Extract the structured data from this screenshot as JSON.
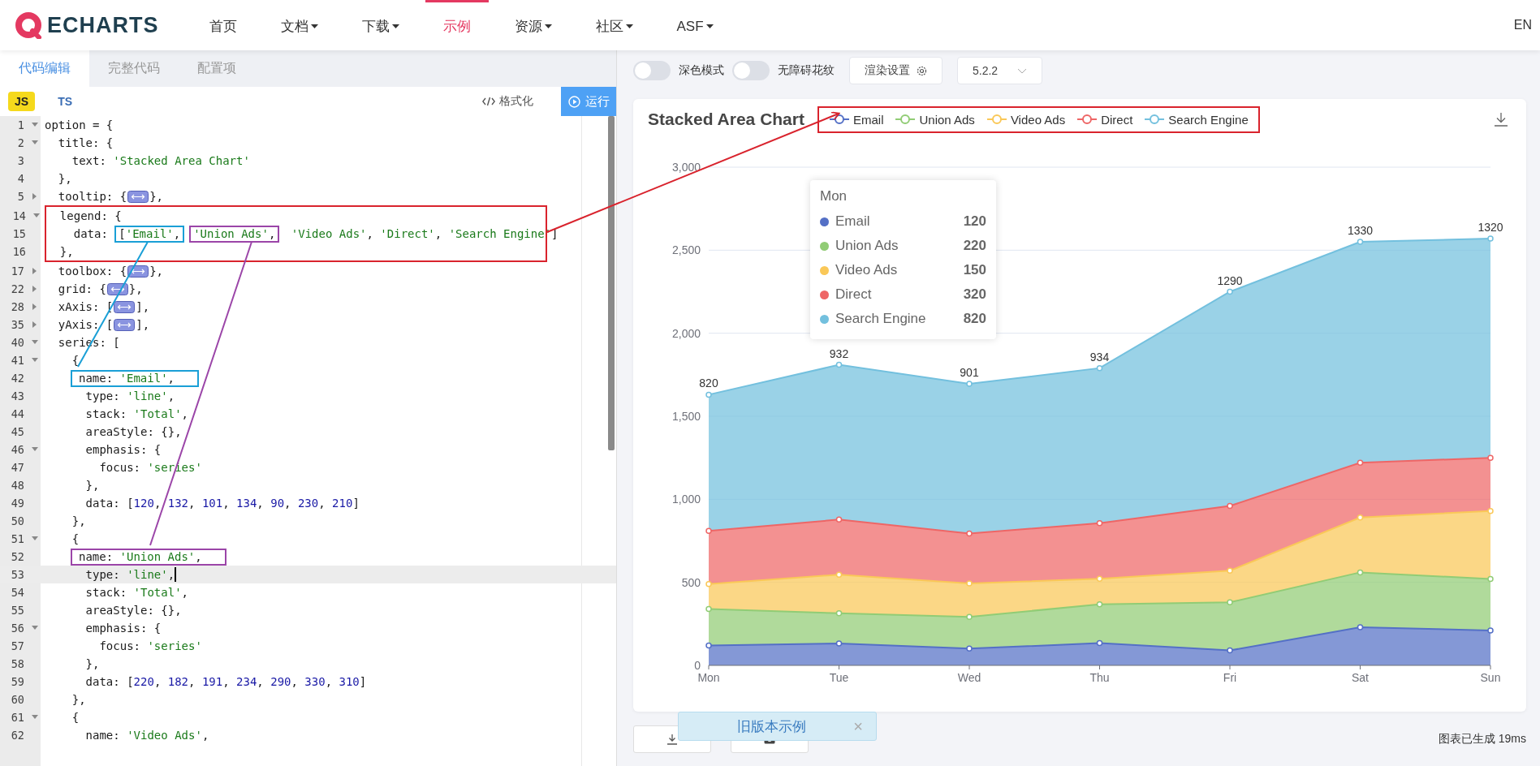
{
  "nav": {
    "logo": "ECHARTS",
    "items": [
      {
        "label": "首页",
        "has_menu": false,
        "selected": false
      },
      {
        "label": "文档",
        "has_menu": true,
        "selected": false
      },
      {
        "label": "下载",
        "has_menu": true,
        "selected": false
      },
      {
        "label": "示例",
        "has_menu": false,
        "selected": true
      },
      {
        "label": "资源",
        "has_menu": true,
        "selected": false
      },
      {
        "label": "社区",
        "has_menu": true,
        "selected": false
      },
      {
        "label": "ASF",
        "has_menu": true,
        "selected": false
      }
    ],
    "language": "EN"
  },
  "editor": {
    "tabs": [
      {
        "label": "代码编辑",
        "selected": true
      },
      {
        "label": "完整代码",
        "selected": false
      },
      {
        "label": "配置项",
        "selected": false
      }
    ],
    "langs": [
      {
        "label": "JS",
        "selected": true
      },
      {
        "label": "TS",
        "selected": false
      }
    ],
    "format_button": "格式化",
    "run_button": "运行",
    "lines": [
      {
        "number": "1",
        "foldable": true,
        "folded": false,
        "current": false,
        "parts": [
          "option = {"
        ]
      },
      {
        "number": "2",
        "foldable": true,
        "folded": false,
        "current": false,
        "parts": [
          "  title: {"
        ]
      },
      {
        "number": "3",
        "foldable": false,
        "current": false,
        "parts": [
          "    text: 'Stacked Area Chart'"
        ]
      },
      {
        "number": "4",
        "foldable": false,
        "current": false,
        "parts": [
          "  },"
        ]
      },
      {
        "number": "5",
        "foldable": true,
        "folded": true,
        "current": false,
        "parts": [
          "  tooltip: {",
          "},"
        ]
      },
      {
        "color": "#d9232d",
        "lines": [
          {
            "number": "14",
            "foldable": true,
            "folded": false,
            "current": false,
            "parts": [
              "  legend: {"
            ]
          },
          {
            "number": "15",
            "foldable": false,
            "current": false,
            "parts": [
              "    data: ",
              {
                "text": "['Email',",
                "color": "#1a9fd6"
              },
              {
                "text": "'Union Ads',",
                "color": "#9b45a8"
              },
              " 'Video Ads', 'Direct', 'Search Engine']"
            ]
          },
          {
            "number": "16",
            "foldable": false,
            "current": false,
            "parts": [
              "  },"
            ]
          }
        ]
      },
      {
        "number": "17",
        "foldable": true,
        "folded": true,
        "current": false,
        "parts": [
          "  toolbox: {",
          "},"
        ]
      },
      {
        "number": "22",
        "foldable": true,
        "folded": true,
        "current": false,
        "parts": [
          "  grid: {",
          "},"
        ]
      },
      {
        "number": "28",
        "foldable": true,
        "folded": true,
        "current": false,
        "parts": [
          "  xAxis: [",
          "],"
        ]
      },
      {
        "number": "35",
        "foldable": true,
        "folded": true,
        "current": false,
        "parts": [
          "  yAxis: [",
          "],"
        ]
      },
      {
        "number": "40",
        "foldable": true,
        "folded": false,
        "current": false,
        "parts": [
          "  series: ["
        ]
      },
      {
        "number": "41",
        "foldable": true,
        "folded": false,
        "current": false,
        "parts": [
          "    {"
        ]
      },
      {
        "number": "42",
        "foldable": false,
        "current": false,
        "parts": [
          {
            "text": "name: 'Email',",
            "color": "#1a9fd6"
          }
        ]
      },
      {
        "number": "43",
        "foldable": false,
        "current": false,
        "parts": [
          "      type: 'line',"
        ]
      },
      {
        "number": "44",
        "foldable": false,
        "current": false,
        "parts": [
          "      stack: 'Total',"
        ]
      },
      {
        "number": "45",
        "foldable": false,
        "current": false,
        "parts": [
          "      areaStyle: {},"
        ]
      },
      {
        "number": "46",
        "foldable": true,
        "folded": false,
        "current": false,
        "parts": [
          "      emphasis: {"
        ]
      },
      {
        "number": "47",
        "foldable": false,
        "current": false,
        "parts": [
          "        focus: 'series'"
        ]
      },
      {
        "number": "48",
        "foldable": false,
        "current": false,
        "parts": [
          "      },"
        ]
      },
      {
        "number": "49",
        "foldable": false,
        "current": false,
        "parts": [
          "      data: [120, 132, 101, 134, 90, 230, 210]"
        ]
      },
      {
        "number": "50",
        "foldable": false,
        "current": false,
        "parts": [
          "    },"
        ]
      },
      {
        "number": "51",
        "foldable": true,
        "folded": false,
        "current": false,
        "parts": [
          "    {"
        ]
      },
      {
        "number": "52",
        "foldable": false,
        "current": false,
        "parts": [
          {
            "text": "name: 'Union Ads',",
            "color": "#9b45a8"
          }
        ]
      },
      {
        "number": "53",
        "foldable": false,
        "current": true,
        "parts": [
          "      type: 'line',"
        ]
      },
      {
        "number": "54",
        "foldable": false,
        "current": false,
        "parts": [
          "      stack: 'Total',"
        ]
      },
      {
        "number": "55",
        "foldable": false,
        "current": false,
        "parts": [
          "      areaStyle: {},"
        ]
      },
      {
        "number": "56",
        "foldable": true,
        "folded": false,
        "current": false,
        "parts": [
          "      emphasis: {"
        ]
      },
      {
        "number": "57",
        "foldable": false,
        "current": false,
        "parts": [
          "        focus: 'series'"
        ]
      },
      {
        "number": "58",
        "foldable": false,
        "current": false,
        "parts": [
          "      },"
        ]
      },
      {
        "number": "59",
        "foldable": false,
        "current": false,
        "parts": [
          "      data: [220, 182, 191, 234, 290, 330, 310]"
        ]
      },
      {
        "number": "60",
        "foldable": false,
        "current": false,
        "parts": [
          "    },"
        ]
      },
      {
        "number": "61",
        "foldable": true,
        "folded": false,
        "current": false,
        "parts": [
          "    {"
        ]
      },
      {
        "number": "62",
        "foldable": false,
        "current": false,
        "parts": [
          "      name: 'Video Ads',"
        ]
      }
    ]
  },
  "preview": {
    "toggles": [
      {
        "label": "深色模式",
        "on": false
      },
      {
        "label": "无障碍花纹",
        "on": false
      }
    ],
    "render_button": "渲染设置",
    "version": "5.2.2",
    "chart": {
      "title": "Stacked Area Chart",
      "chart_data": {
        "type": "area",
        "stacked": true,
        "grid": true,
        "categories": [
          "Mon",
          "Tue",
          "Wed",
          "Thu",
          "Fri",
          "Sat",
          "Sun"
        ],
        "ylim": [
          0,
          3000
        ],
        "yticks": [
          {
            "value": 0,
            "label": "0"
          },
          {
            "value": 500,
            "label": "500"
          },
          {
            "value": 1000,
            "label": "1,000"
          },
          {
            "value": 1500,
            "label": "1,500"
          },
          {
            "value": 2000,
            "label": "2,000"
          },
          {
            "value": 2500,
            "label": "2,500"
          },
          {
            "value": 3000,
            "label": "3,000"
          }
        ],
        "series": [
          {
            "name": "Email",
            "color": "#5470c6",
            "values": [
              120,
              132,
              101,
              134,
              90,
              230,
              210
            ]
          },
          {
            "name": "Union Ads",
            "color": "#91cc75",
            "values": [
              220,
              182,
              191,
              234,
              290,
              330,
              310
            ]
          },
          {
            "name": "Video Ads",
            "color": "#fac858",
            "values": [
              150,
              232,
              201,
              154,
              190,
              330,
              410
            ]
          },
          {
            "name": "Direct",
            "color": "#ee6666",
            "values": [
              320,
              332,
              301,
              334,
              390,
              330,
              320
            ]
          },
          {
            "name": "Search Engine",
            "color": "#73c0de",
            "values": [
              820,
              932,
              901,
              934,
              1290,
              1330,
              1320
            ],
            "value_labels": [
              "820",
              "932",
              "901",
              "934",
              "1290",
              "1330",
              "1320"
            ]
          }
        ]
      },
      "tooltip": {
        "title": "Mon",
        "rows": [
          {
            "name": "Email",
            "value": "120",
            "color": "#5470c6"
          },
          {
            "name": "Union Ads",
            "value": "220",
            "color": "#91cc75"
          },
          {
            "name": "Video Ads",
            "value": "150",
            "color": "#fac858"
          },
          {
            "name": "Direct",
            "value": "320",
            "color": "#ee6666"
          },
          {
            "name": "Search Engine",
            "value": "820",
            "color": "#73c0de"
          }
        ]
      }
    },
    "status": "图表已生成 19ms",
    "old_version_banner": "旧版本示例",
    "banner_close": "×"
  },
  "connectors": [
    {
      "color": "#d9232d"
    },
    {
      "color": "#1a9fd6"
    },
    {
      "color": "#9b45a8"
    }
  ]
}
